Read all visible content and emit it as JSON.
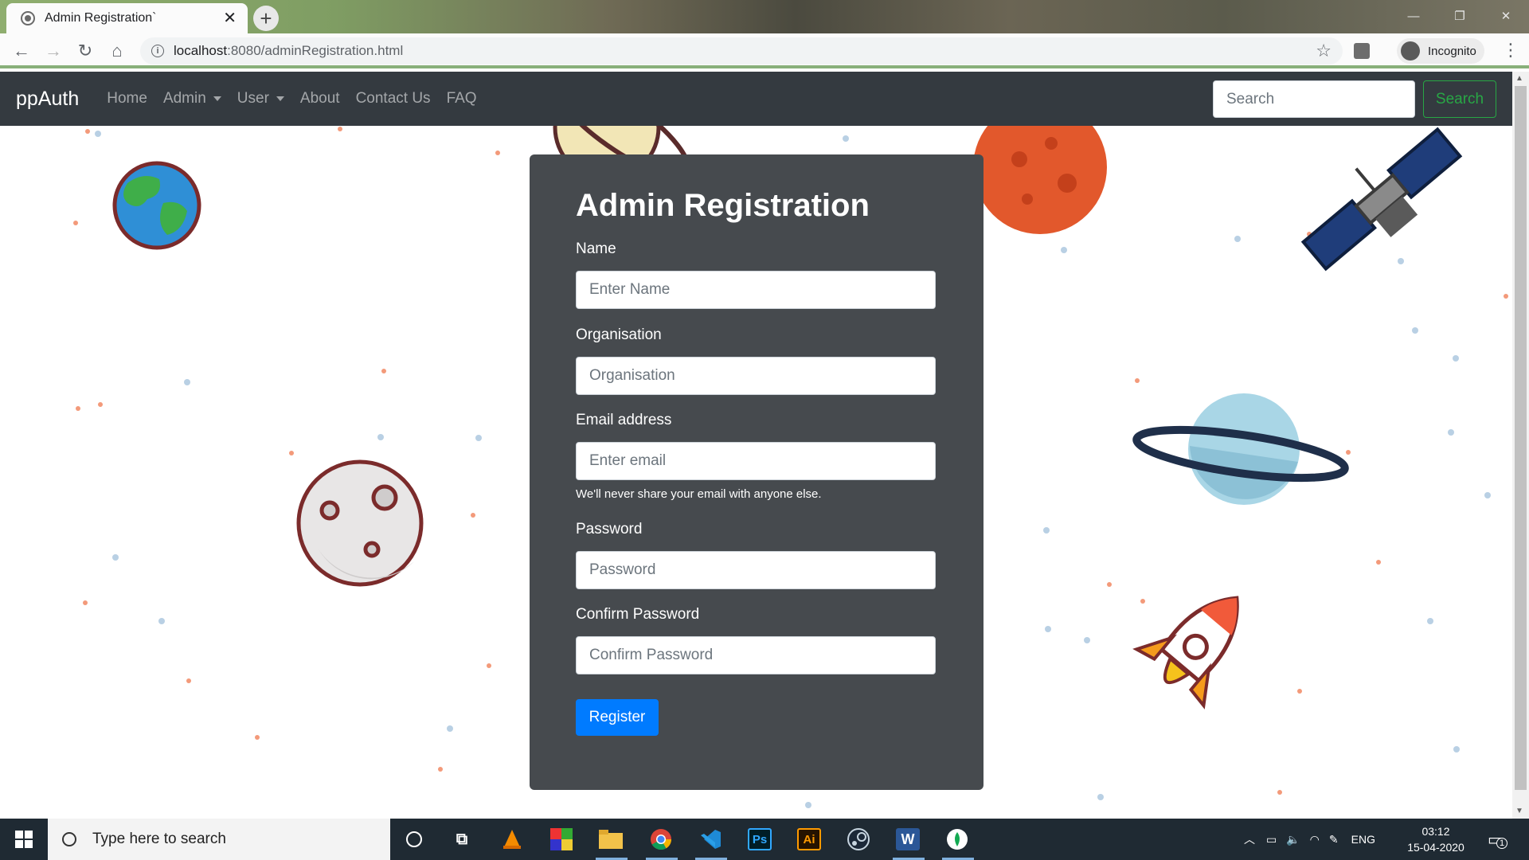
{
  "browser": {
    "tab_title": "Admin Registration`",
    "tab_close": "✕",
    "new_tab": "+",
    "url_host": "localhost",
    "url_rest": ":8080/adminRegistration.html",
    "incognito_label": "Incognito",
    "window_controls": [
      "—",
      "❐",
      "✕"
    ]
  },
  "navbar": {
    "brand": "ppAuth",
    "links": [
      {
        "label": "Home",
        "dropdown": false
      },
      {
        "label": "Admin",
        "dropdown": true
      },
      {
        "label": "User",
        "dropdown": true
      },
      {
        "label": "About",
        "dropdown": false
      },
      {
        "label": "Contact Us",
        "dropdown": false
      },
      {
        "label": "FAQ",
        "dropdown": false
      }
    ],
    "search_placeholder": "Search",
    "search_button": "Search"
  },
  "form": {
    "title": "Admin Registration",
    "name_label": "Name",
    "name_placeholder": "Enter Name",
    "org_label": "Organisation",
    "org_placeholder": "Organisation",
    "email_label": "Email address",
    "email_placeholder": "Enter email",
    "email_help": "We'll never share your email with anyone else.",
    "password_label": "Password",
    "password_placeholder": "Password",
    "confirm_label": "Confirm Password",
    "confirm_placeholder": "Confirm Password",
    "register_button": "Register"
  },
  "taskbar": {
    "search_placeholder": "Type here to search",
    "apps": [
      "cortana-icon",
      "task-view-icon",
      "vlc-icon",
      "winrar-icon",
      "file-explorer-icon",
      "chrome-icon",
      "vscode-icon",
      "photoshop-icon",
      "illustrator-icon",
      "steam-icon",
      "word-icon",
      "mongodb-compass-icon"
    ],
    "ps_label": "Ps",
    "ai_label": "Ai",
    "word_label": "W",
    "language": "ENG",
    "time": "03:12",
    "date": "15-04-2020",
    "notification_count": "1"
  },
  "colors": {
    "navbar_bg": "#343a40",
    "card_bg": "#464a4e",
    "primary": "#007bff",
    "success": "#28a745"
  }
}
